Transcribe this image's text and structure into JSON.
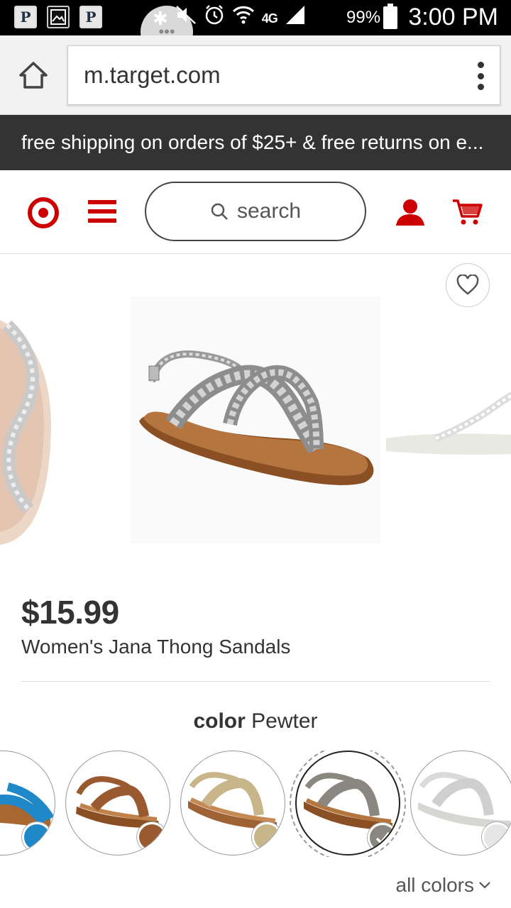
{
  "status_bar": {
    "app_icons": [
      "P",
      "P"
    ],
    "battery": "99%",
    "network": "4G",
    "time": "3:00 PM"
  },
  "browser": {
    "url": "m.target.com",
    "home_icon": "home-icon",
    "menu_icon": "overflow-menu-icon"
  },
  "promo": {
    "text": "free shipping on orders of $25+ & free returns on e..."
  },
  "header": {
    "search_placeholder": "search",
    "brand_color": "#cc0000"
  },
  "product": {
    "price": "$15.99",
    "title": "Women's Jana Thong Sandals",
    "color_label": "color",
    "color_value": "Pewter",
    "swatches": [
      {
        "name": "turquoise",
        "color": "#1e88c8"
      },
      {
        "name": "cognac",
        "color": "#9a5a30"
      },
      {
        "name": "gold",
        "color": "#c9b58a"
      },
      {
        "name": "pewter",
        "color": "#8a8680",
        "selected": true
      },
      {
        "name": "silver",
        "color": "#e6e6e6"
      }
    ],
    "all_colors_label": "all colors"
  }
}
